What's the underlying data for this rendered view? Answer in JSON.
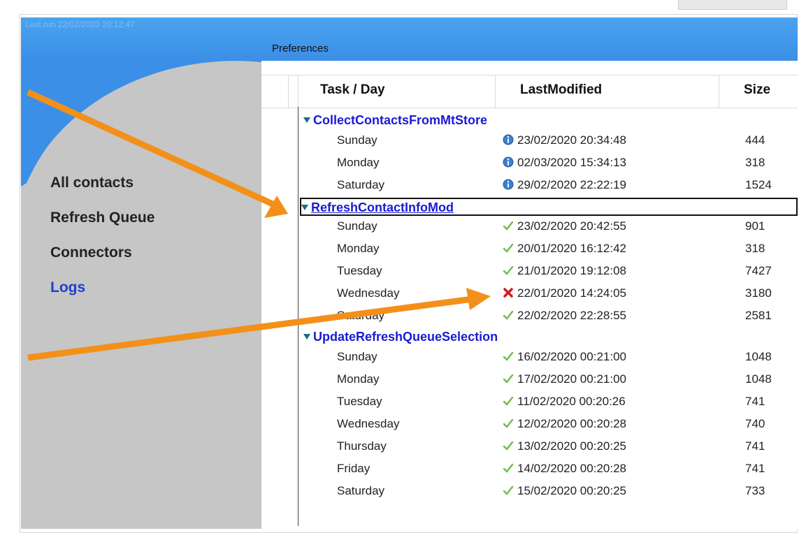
{
  "header": {
    "last_run": "Last run 22/02/2020 20:12:47",
    "title": "Preferences"
  },
  "sidebar": {
    "items": [
      {
        "label": "All contacts"
      },
      {
        "label": "Refresh Queue"
      },
      {
        "label": "Connectors"
      },
      {
        "label": "Logs"
      }
    ]
  },
  "table": {
    "columns": [
      "Task / Day",
      "LastModified",
      "Size"
    ],
    "groups": [
      {
        "name": "CollectContactsFromMtStore",
        "rows": [
          {
            "day": "Sunday",
            "status": "info",
            "date": "23/02/2020 20:34:48",
            "size": "444"
          },
          {
            "day": "Monday",
            "status": "info",
            "date": "02/03/2020 15:34:13",
            "size": "318"
          },
          {
            "day": "Saturday",
            "status": "info",
            "date": "29/02/2020 22:22:19",
            "size": "1524"
          }
        ]
      },
      {
        "name": "RefreshContactInfoMod",
        "rows": [
          {
            "day": "Sunday",
            "status": "ok",
            "date": "23/02/2020 20:42:55",
            "size": "901"
          },
          {
            "day": "Monday",
            "status": "ok",
            "date": "20/01/2020 16:12:42",
            "size": "318"
          },
          {
            "day": "Tuesday",
            "status": "ok",
            "date": "21/01/2020 19:12:08",
            "size": "7427"
          },
          {
            "day": "Wednesday",
            "status": "error",
            "date": "22/01/2020 14:24:05",
            "size": "3180"
          },
          {
            "day": "Saturday",
            "status": "ok",
            "date": "22/02/2020 22:28:55",
            "size": "2581"
          }
        ]
      },
      {
        "name": "UpdateRefreshQueueSelection",
        "rows": [
          {
            "day": "Sunday",
            "status": "ok",
            "date": "16/02/2020 00:21:00",
            "size": "1048"
          },
          {
            "day": "Monday",
            "status": "ok",
            "date": "17/02/2020 00:21:00",
            "size": "1048"
          },
          {
            "day": "Tuesday",
            "status": "ok",
            "date": "11/02/2020 00:20:26",
            "size": "741"
          },
          {
            "day": "Wednesday",
            "status": "ok",
            "date": "12/02/2020 00:20:28",
            "size": "740"
          },
          {
            "day": "Thursday",
            "status": "ok",
            "date": "13/02/2020 00:20:25",
            "size": "741"
          },
          {
            "day": "Friday",
            "status": "ok",
            "date": "14/02/2020 00:20:28",
            "size": "741"
          },
          {
            "day": "Saturday",
            "status": "ok",
            "date": "15/02/2020 00:20:25",
            "size": "733"
          }
        ]
      }
    ]
  },
  "icons": {
    "info": "info-icon",
    "ok": "checkmark-icon",
    "error": "error-x-icon"
  },
  "colors": {
    "header": "#3b8fe6",
    "sidebar": "#c6c6c6",
    "link": "#1e3fcf",
    "group": "#1a1ad6",
    "arrow": "#f39019",
    "error": "#d11a1a",
    "ok": "#6cc04a"
  }
}
